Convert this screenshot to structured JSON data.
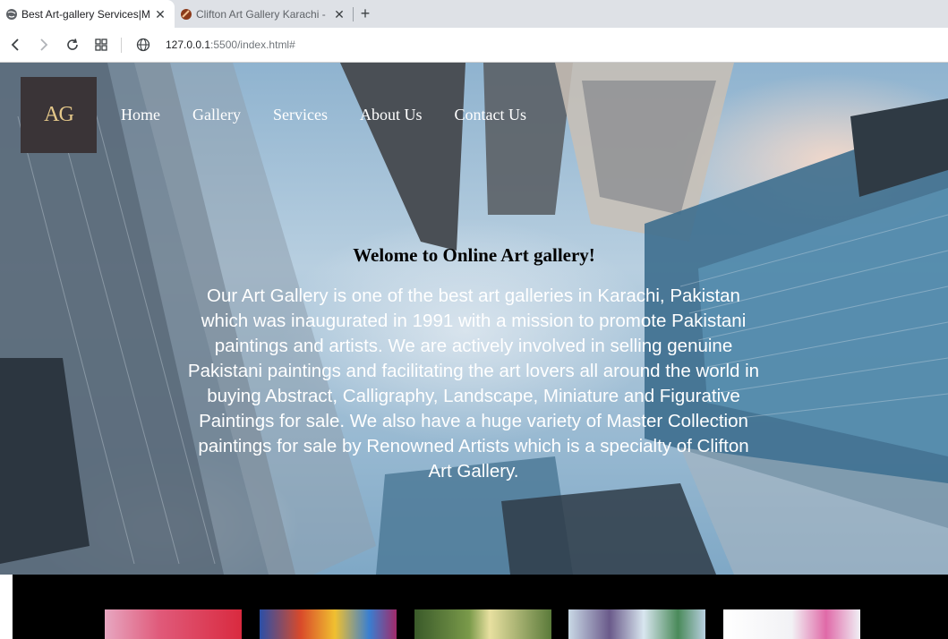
{
  "browser": {
    "tabs": [
      {
        "title": "Best Art-gallery Services|M",
        "active": true
      },
      {
        "title": "Clifton Art Gallery Karachi -",
        "active": false
      }
    ],
    "close_glyph": "✕",
    "new_tab_glyph": "+",
    "url_host": "127.0.0.1",
    "url_rest": ":5500/index.html#"
  },
  "site": {
    "logo_text": "AG",
    "nav": {
      "home": "Home",
      "gallery": "Gallery",
      "services": "Services",
      "about": "About Us",
      "contact": "Contact Us"
    },
    "welcome_heading": "Welome to Online Art gallery!",
    "intro_text": "Our Art Gallery is one of the best art galleries in Karachi, Pakistan which was inaugurated in 1991 with a mission to promote Pakistani paintings and artists. We are actively involved in selling genuine Pakistani paintings and facilitating the art lovers all around the world in buying Abstract, Calligraphy, Landscape, Miniature and Figurative Paintings for sale. We also have a huge variety of Master Collection paintings for sale by Renowned Artists which is a specialty of Clifton Art Gallery."
  },
  "colors": {
    "nav_text": "#ffffff",
    "strip_bg": "#000000"
  }
}
